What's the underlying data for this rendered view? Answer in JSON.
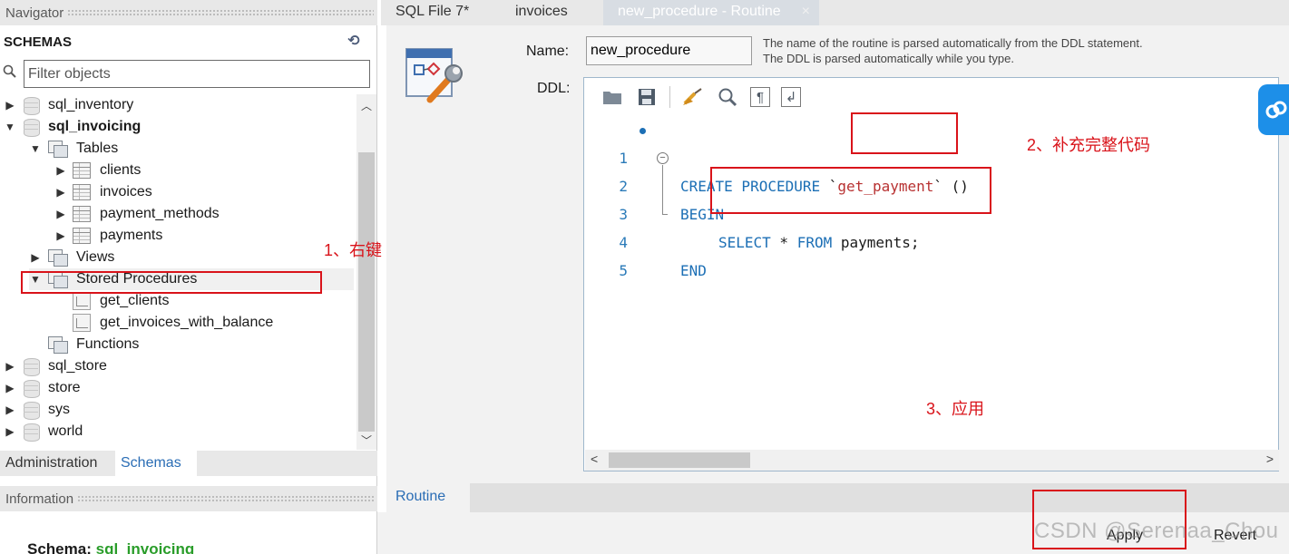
{
  "navigator": {
    "header": "Navigator",
    "schemas_title": "SCHEMAS",
    "filter_placeholder": "Filter objects",
    "tree": {
      "sql_inventory": "sql_inventory",
      "sql_invoicing": "sql_invoicing",
      "tables": "Tables",
      "clients": "clients",
      "invoices": "invoices",
      "payment_methods": "payment_methods",
      "payments": "payments",
      "views": "Views",
      "stored_procedures": "Stored Procedures",
      "get_clients": "get_clients",
      "get_invoices_with_balance": "get_invoices_with_balance",
      "functions": "Functions",
      "sql_store": "sql_store",
      "store": "store",
      "sys": "sys",
      "world": "world"
    },
    "tabs": {
      "administration": "Administration",
      "schemas": "Schemas"
    },
    "information_header": "Information",
    "schema_info_label": "Schema:",
    "schema_info_value": "sql_invoicing"
  },
  "editor_tabs": {
    "sql_file": "SQL File 7*",
    "invoices": "invoices",
    "routine": "new_procedure - Routine",
    "close": "×"
  },
  "routine": {
    "name_label": "Name:",
    "name_value": "new_procedure",
    "name_hint": "The name of the routine is parsed automatically from the DDL statement. The DDL is parsed automatically while you type.",
    "ddl_label": "DDL:",
    "code": {
      "line_numbers": [
        "1",
        "2",
        "3",
        "4",
        "5"
      ],
      "create_procedure": "CREATE PROCEDURE ",
      "tick_open": "`",
      "proc_name": "get_payment",
      "tick_close": "` ()",
      "begin": "BEGIN",
      "select": "SELECT",
      "star": " * ",
      "from": "FROM",
      "table": " payments;",
      "end": "END"
    },
    "bottom_tab": "Routine",
    "apply": "Apply",
    "revert": "Revert"
  },
  "annotations": {
    "step1": "1、右键",
    "step2": "2、补充完整代码",
    "step3": "3、应用"
  },
  "watermark": "CSDN @Serenaa_Chou",
  "colors": {
    "annotation": "#d9131a",
    "keyword": "#1c6fb5",
    "link": "#2a6db5",
    "float_button": "#1d8fe8"
  }
}
